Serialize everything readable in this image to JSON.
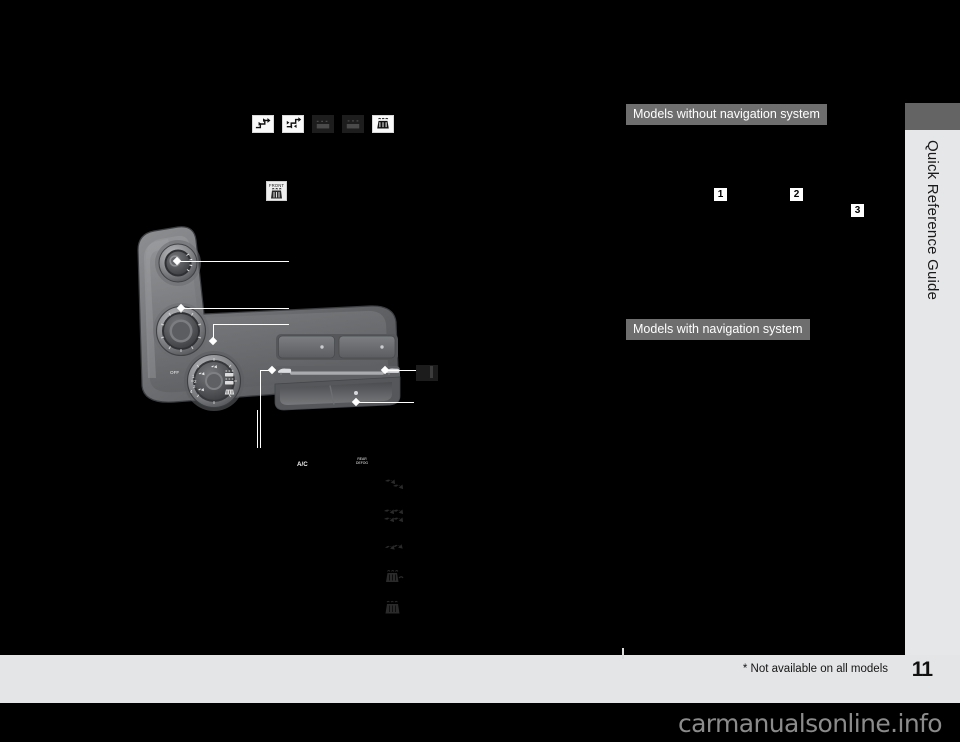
{
  "document": {
    "title": "Quick Reference Guide",
    "page_number": "11",
    "footnote": "* Not available on all models",
    "watermark": "carmanualsonline.info"
  },
  "side_tab": {
    "label": "Quick Reference Guide"
  },
  "captions": [
    {
      "id": "no-nav",
      "text": "Models without navigation system"
    },
    {
      "id": "nav",
      "text": "Models with navigation system"
    }
  ],
  "callouts": [
    {
      "number": "1"
    },
    {
      "number": "2"
    },
    {
      "number": "3"
    }
  ],
  "illustration": {
    "name": "climate-control-panel",
    "top_icons": [
      {
        "name": "fresh-air-intake-icon",
        "style": "light"
      },
      {
        "name": "recirculation-icon",
        "style": "light"
      },
      {
        "name": "rear-defroster-icon",
        "style": "dark"
      },
      {
        "name": "mirror-defroster-icon",
        "style": "dark"
      },
      {
        "name": "front-defroster-icon",
        "style": "light"
      }
    ],
    "front_defroster": {
      "name": "front-defroster-button-icon",
      "label": "FRONT"
    },
    "mode_icons": [
      {
        "name": "vent-mode-icon"
      },
      {
        "name": "vent-floor-mode-icon"
      },
      {
        "name": "floor-mode-icon"
      },
      {
        "name": "floor-defrost-mode-icon"
      },
      {
        "name": "defrost-mode-icon"
      }
    ],
    "fan_dial": {
      "name": "fan-speed-dial",
      "off_label": "OFF",
      "ticks": [
        "1",
        "2",
        "3",
        "4"
      ]
    },
    "temp_dial": {
      "name": "temperature-dial"
    },
    "mode_dial": {
      "name": "mode-selector-dial"
    },
    "panel_buttons": [
      {
        "name": "ac-button",
        "label": "A/C"
      },
      {
        "name": "recirculation-button",
        "label": "REAR\nDEFOG"
      }
    ],
    "slider": {
      "name": "temperature-slider"
    }
  },
  "colors": {
    "page_background": "#000000",
    "caption_bar": "#6e6e6e",
    "tab_background": "#e6e7e9",
    "tab_cap": "#646464",
    "footer_band": "#e4e5e7",
    "watermark": "#8b8b8b",
    "leader_line": "#ffffff"
  }
}
